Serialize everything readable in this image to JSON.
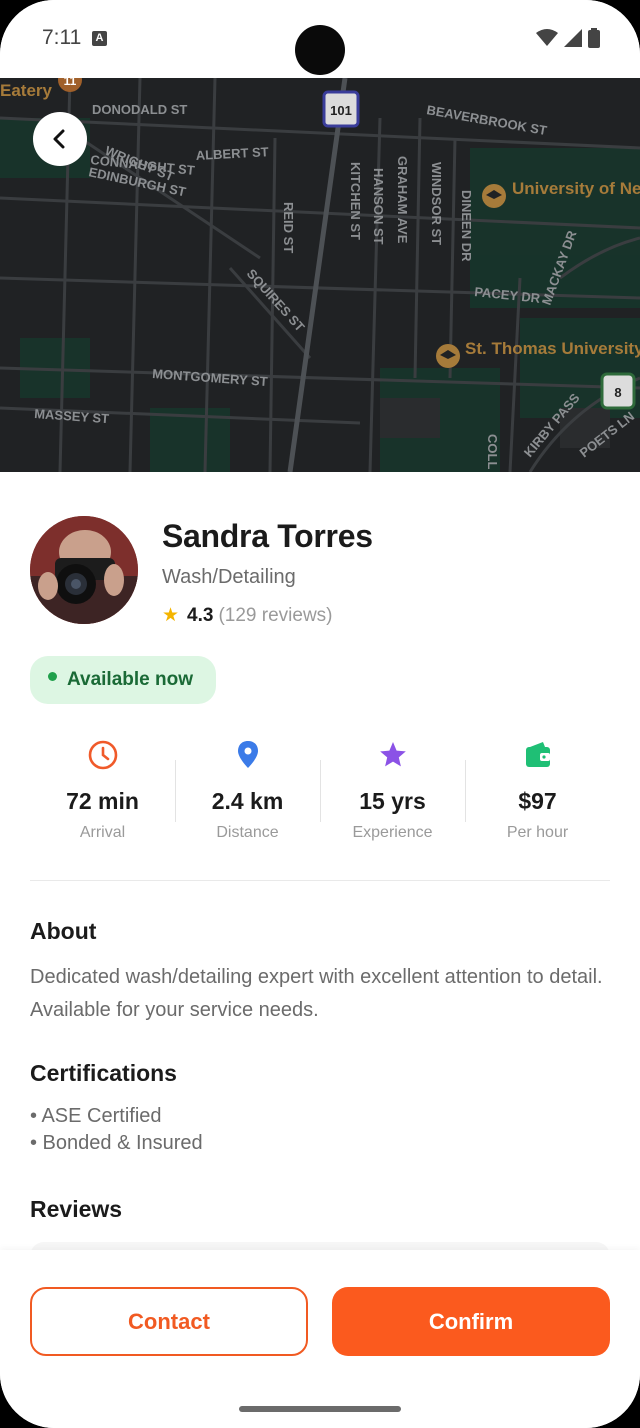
{
  "status_bar": {
    "time": "7:11",
    "notification_icon": "A"
  },
  "map": {
    "streets": [
      "DONODALD ST",
      "CONNAUGHT ST",
      "ALBERT ST",
      "WRIGHT ST",
      "EDINBURGH ST",
      "REID ST",
      "KITCHEN ST",
      "HANSON ST",
      "GRAHAM AVE",
      "WINDSOR ST",
      "DINEEN DR",
      "MACKAY DR",
      "PACEY DR",
      "SQUIRES ST",
      "MONTGOMERY ST",
      "MASSEY ST",
      "BEAVERBROOK ST",
      "COLL",
      "KIRBY PASS",
      "POETS LN"
    ],
    "route_shields": [
      "101",
      "8",
      "11"
    ],
    "places": [
      "University of New Brunswick",
      "St. Thomas University",
      "Eatery"
    ]
  },
  "provider": {
    "name": "Sandra Torres",
    "service": "Wash/Detailing",
    "rating": "4.3",
    "reviews_count": "(129 reviews)",
    "availability": "Available now"
  },
  "stats": [
    {
      "icon": "clock-icon",
      "value": "72 min",
      "label": "Arrival",
      "color": "#f05a2a"
    },
    {
      "icon": "location-pin-icon",
      "value": "2.4 km",
      "label": "Distance",
      "color": "#3b7be8"
    },
    {
      "icon": "star-icon",
      "value": "15 yrs",
      "label": "Experience",
      "color": "#8b52e6"
    },
    {
      "icon": "wallet-icon",
      "value": "$97",
      "label": "Per hour",
      "color": "#1fbf75"
    }
  ],
  "about": {
    "title": "About",
    "text": "Dedicated wash/detailing expert with excellent attention to detail. Available for your service needs."
  },
  "certifications": {
    "title": "Certifications",
    "items": [
      "• ASE Certified",
      "• Bonded & Insured"
    ]
  },
  "reviews": {
    "title": "Reviews"
  },
  "actions": {
    "contact_label": "Contact",
    "confirm_label": "Confirm"
  },
  "colors": {
    "accent": "#fb5a1e",
    "available_bg": "#ddf6e3",
    "available_text": "#1a6a36",
    "rating_star": "#f4b400"
  }
}
